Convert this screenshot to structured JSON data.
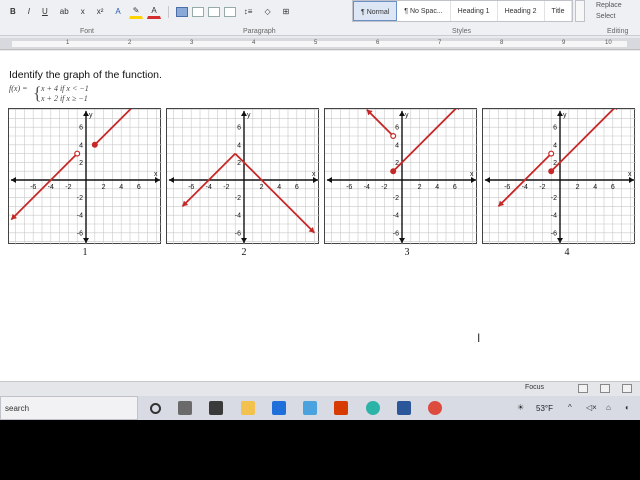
{
  "ribbon": {
    "font_buttons": [
      "B",
      "I",
      "U",
      "ab",
      "x",
      "x²",
      "A",
      "A"
    ],
    "group_font": "Font",
    "group_paragraph": "Paragraph",
    "group_styles": "Styles",
    "group_editing": "Editing",
    "styles": [
      "¶ Normal",
      "¶ No Spac...",
      "Heading 1",
      "Heading 2",
      "Title"
    ],
    "editing": [
      "Replace",
      "Select"
    ]
  },
  "ruler": {
    "numbers": [
      "1",
      "2",
      "3",
      "4",
      "5",
      "6",
      "7",
      "8",
      "9",
      "10"
    ]
  },
  "document": {
    "question": "Identify the graph of the function.",
    "func_name": "f(x) =",
    "case1": "x + 4 if x < −1",
    "case2": "x + 2 if x ≥ −1",
    "graph_labels": [
      "1",
      "2",
      "3",
      "4"
    ],
    "tick_labels_x": [
      "-6",
      "-4",
      "-2",
      "2",
      "4",
      "6"
    ],
    "tick_labels_y": [
      "6",
      "4",
      "2",
      "-2",
      "-4",
      "-6"
    ],
    "axis_x": "x",
    "axis_y": "y",
    "line_color": "#c62828"
  },
  "status": {
    "focus": "Focus"
  },
  "taskbar": {
    "search": "search",
    "temperature": "53°F"
  }
}
